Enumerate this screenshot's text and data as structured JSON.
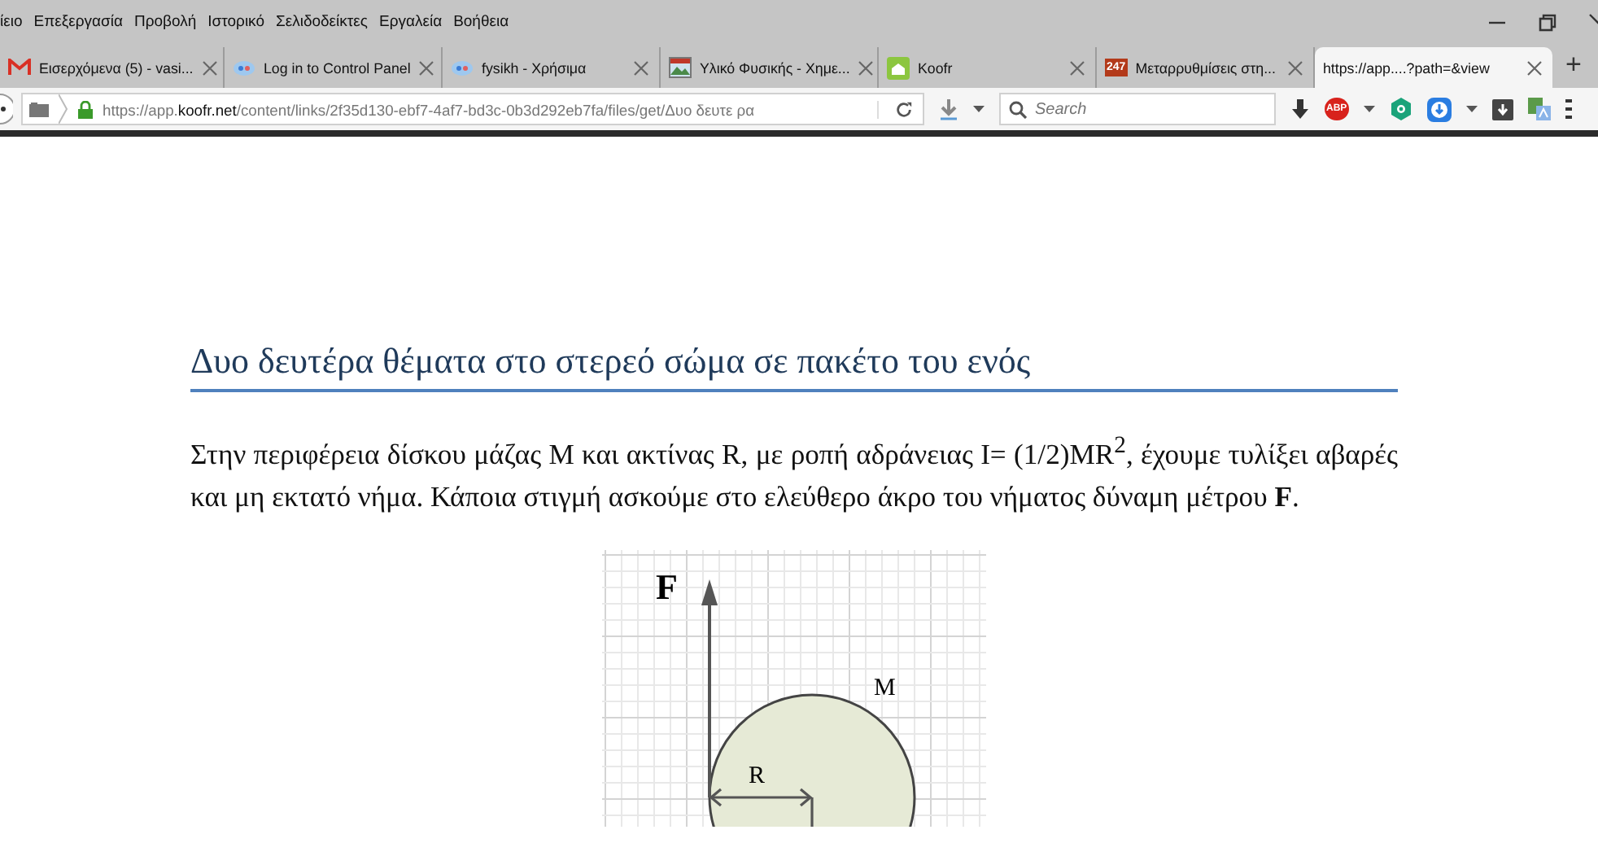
{
  "menu_bar": [
    "ίειο",
    "Επεξεργασία",
    "Προβολή",
    "Ιστορικό",
    "Σελιδοδείκτες",
    "Εργαλεία",
    "Βοήθεια"
  ],
  "tabs": [
    {
      "title": "Εισερχόμενα (5) - vasi...",
      "kind": "mail",
      "selected": false
    },
    {
      "title": "Log in to Control Panel",
      "kind": "bubble",
      "selected": false
    },
    {
      "title": "fysikh - Χρήσιμα",
      "kind": "bubble",
      "selected": false
    },
    {
      "title": "Υλικό Φυσικής - Χημε...",
      "kind": "picture",
      "selected": false
    },
    {
      "title": "Koofr",
      "kind": "house",
      "selected": false
    },
    {
      "title": "Μεταρρυθμίσεις στη...",
      "kind": "badge",
      "icon_text": "247",
      "selected": false
    },
    {
      "title": "https://app....?path=&view",
      "kind": "plain",
      "selected": true
    }
  ],
  "new_tab": "+",
  "url": "https://app.**koofr.net**/content/links/2f35d130-ebf7-4af7-bd3c-0b3d292eb7fa/files/get/Δυο δευτε ρα",
  "search": {
    "placeholder": "Search"
  },
  "adblock_label": "ABP",
  "page": {
    "heading": "Δυο δευτέρα θέματα στο στερεό σώμα σε πακέτο του ενός",
    "paragraph": "Στην περιφέρεια δίσκου μάζας Μ και ακτίνας R, με ροπή αδράνειας I= (1/2)MR$^{2}$, έχουμε τυλίξει αβαρές και μη εκτατό νήμα. Κάποια στιγμή ασκούμε στο ελεύθερο άκρο του νήματος δύναμη μέτρου **F**.",
    "figure": {
      "force_label": "F",
      "mass_label": "M",
      "radius_label": "R"
    }
  }
}
